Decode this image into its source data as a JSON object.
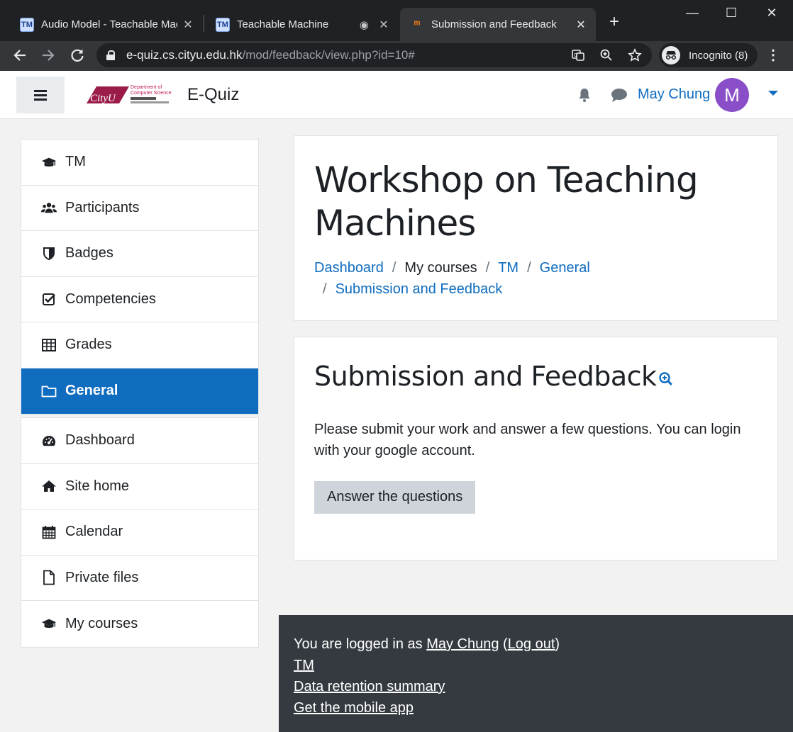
{
  "browser": {
    "tabs": [
      {
        "title": "Audio Model - Teachable Mac",
        "favicon": "TM"
      },
      {
        "title": "Teachable Machine",
        "favicon": "TM"
      },
      {
        "title": "Submission and Feedback",
        "favicon": "moodle"
      }
    ],
    "url_host": "e-quiz.cs.cityu.edu.hk",
    "url_path": "/mod/feedback/view.php?id=10#",
    "incognito_label": "Incognito (8)"
  },
  "navbar": {
    "logo_text": "CityU",
    "logo_dept": "Department of Computer Science",
    "site_name": "E-Quiz",
    "user_name": "May Chung",
    "avatar_initial": "M"
  },
  "drawer": {
    "course_items": [
      {
        "label": "TM",
        "icon": "graduation-cap-icon"
      },
      {
        "label": "Participants",
        "icon": "users-icon"
      },
      {
        "label": "Badges",
        "icon": "shield-icon"
      },
      {
        "label": "Competencies",
        "icon": "check-square-icon"
      },
      {
        "label": "Grades",
        "icon": "table-icon"
      },
      {
        "label": "General",
        "icon": "folder-icon",
        "active": true
      }
    ],
    "site_items": [
      {
        "label": "Dashboard",
        "icon": "tachometer-icon"
      },
      {
        "label": "Site home",
        "icon": "home-icon"
      },
      {
        "label": "Calendar",
        "icon": "calendar-icon"
      },
      {
        "label": "Private files",
        "icon": "file-icon"
      },
      {
        "label": "My courses",
        "icon": "graduation-cap-icon"
      }
    ]
  },
  "header": {
    "title": "Workshop on Teaching Machines",
    "breadcrumb": [
      "Dashboard",
      "My courses",
      "TM",
      "General",
      "Submission and Feedback"
    ]
  },
  "activity": {
    "title": "Submission and Feedback",
    "intro": "Please submit your work and answer a few questions. You can login with your google account.",
    "button_label": "Answer the questions"
  },
  "footer": {
    "logged_in_prefix": "You are logged in as ",
    "user_name": "May Chung",
    "open_paren": " (",
    "logout_label": "Log out",
    "close_paren": ")",
    "course_link": "TM",
    "data_retention": "Data retention summary",
    "mobile_app": "Get the mobile app"
  },
  "colors": {
    "primary": "#0f6cbf",
    "footer_bg": "#343a40",
    "avatar_bg": "#8a4fc8",
    "chrome_dark": "#202124"
  }
}
